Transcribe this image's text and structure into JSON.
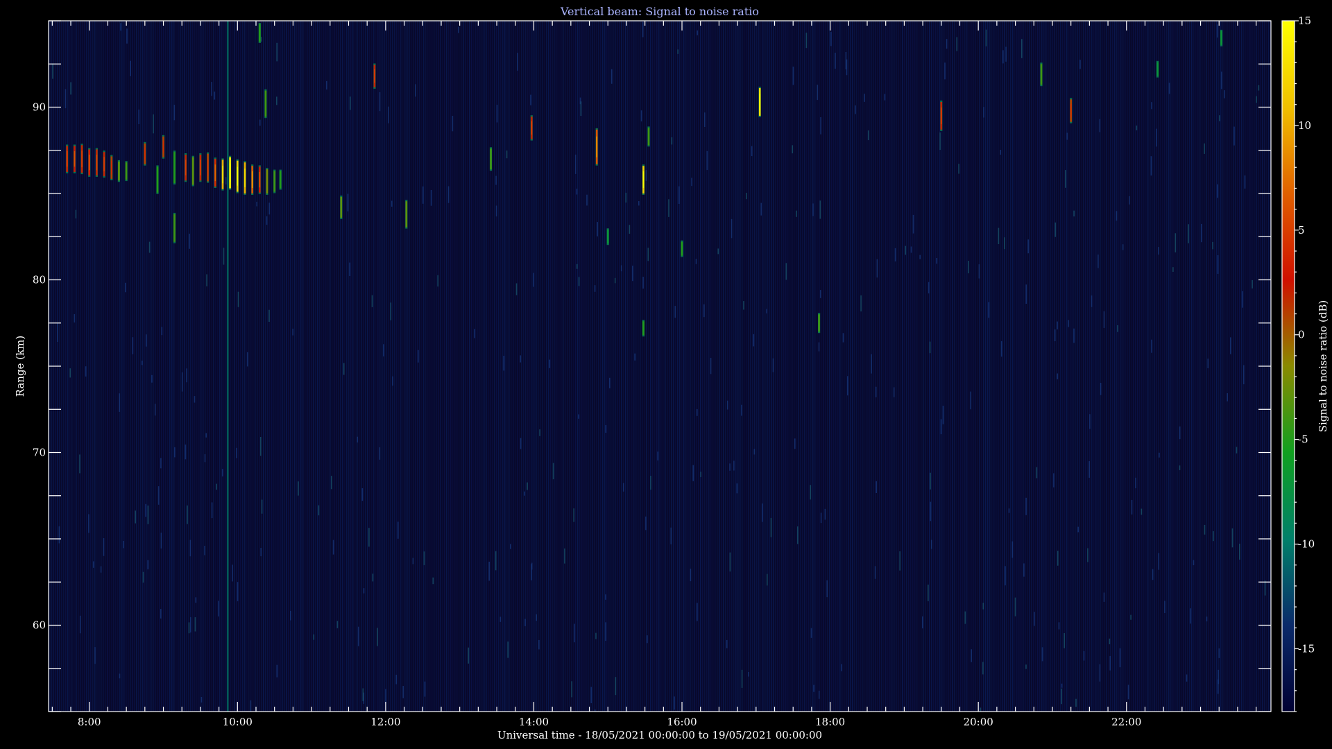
{
  "chart_data": {
    "type": "heatmap",
    "title": "Vertical beam: Signal to noise ratio",
    "xlabel": "Universal time - 18/05/2021 00:00:00 to 19/05/2021 00:00:00",
    "ylabel": "Range (km)",
    "colorbar_label": "Signal to noise ratio (dB)",
    "xlim": [
      7.45,
      23.95
    ],
    "ylim": [
      55,
      95
    ],
    "x_ticks": [
      8,
      10,
      12,
      14,
      16,
      18,
      20,
      22
    ],
    "x_tick_labels": [
      "8:00",
      "10:00",
      "12:00",
      "14:00",
      "16:00",
      "18:00",
      "20:00",
      "22:00"
    ],
    "y_ticks": [
      60,
      70,
      80,
      90
    ],
    "y_tick_labels": [
      "60",
      "70",
      "80",
      "90"
    ],
    "clim": [
      -18,
      15
    ],
    "colorbar_ticks": [
      -15,
      -10,
      -5,
      0,
      5,
      10,
      15
    ],
    "colorbar_tick_labels": [
      "-15",
      "-10",
      "-5",
      "0",
      "5",
      "10",
      "15"
    ],
    "colormap": [
      "#000033",
      "#0a2a6a",
      "#00806a",
      "#10a020",
      "#8a8a00",
      "#d01000",
      "#e06000",
      "#f0c000",
      "#ffff00"
    ],
    "background_color": "#08082a",
    "echoes": [
      {
        "t": 7.7,
        "r": 87.0,
        "h": 1.5,
        "snr": 2
      },
      {
        "t": 7.8,
        "r": 87.0,
        "h": 1.5,
        "snr": 3
      },
      {
        "t": 7.9,
        "r": 87.0,
        "h": 1.6,
        "snr": 2
      },
      {
        "t": 8.0,
        "r": 86.8,
        "h": 1.5,
        "snr": 3
      },
      {
        "t": 8.1,
        "r": 86.8,
        "h": 1.5,
        "snr": 2
      },
      {
        "t": 8.2,
        "r": 86.7,
        "h": 1.4,
        "snr": 2
      },
      {
        "t": 8.3,
        "r": 86.5,
        "h": 1.3,
        "snr": 1
      },
      {
        "t": 8.4,
        "r": 86.3,
        "h": 1.1,
        "snr": -3
      },
      {
        "t": 8.5,
        "r": 86.3,
        "h": 1.0,
        "snr": -4
      },
      {
        "t": 8.75,
        "r": 87.3,
        "h": 1.2,
        "snr": 1
      },
      {
        "t": 8.92,
        "r": 85.8,
        "h": 1.5,
        "snr": -5
      },
      {
        "t": 9.0,
        "r": 87.7,
        "h": 1.2,
        "snr": 1
      },
      {
        "t": 9.15,
        "r": 83.0,
        "h": 1.6,
        "snr": -4
      },
      {
        "t": 9.15,
        "r": 86.5,
        "h": 1.8,
        "snr": -5
      },
      {
        "t": 9.3,
        "r": 86.5,
        "h": 1.5,
        "snr": 2
      },
      {
        "t": 9.4,
        "r": 86.3,
        "h": 1.6,
        "snr": -3
      },
      {
        "t": 9.5,
        "r": 86.5,
        "h": 1.5,
        "snr": 2
      },
      {
        "t": 9.6,
        "r": 86.5,
        "h": 1.6,
        "snr": 1
      },
      {
        "t": 9.7,
        "r": 86.2,
        "h": 1.6,
        "snr": 4
      },
      {
        "t": 9.8,
        "r": 86.1,
        "h": 1.7,
        "snr": 10
      },
      {
        "t": 9.9,
        "r": 86.2,
        "h": 1.8,
        "snr": 14
      },
      {
        "t": 10.0,
        "r": 86.0,
        "h": 1.8,
        "snr": 12
      },
      {
        "t": 10.1,
        "r": 85.9,
        "h": 1.8,
        "snr": 10
      },
      {
        "t": 10.2,
        "r": 85.8,
        "h": 1.6,
        "snr": 6
      },
      {
        "t": 10.3,
        "r": 85.8,
        "h": 1.5,
        "snr": 3
      },
      {
        "t": 10.4,
        "r": 85.7,
        "h": 1.4,
        "snr": -2
      },
      {
        "t": 10.5,
        "r": 85.7,
        "h": 1.2,
        "snr": -4
      },
      {
        "t": 10.58,
        "r": 85.8,
        "h": 1.0,
        "snr": -5
      },
      {
        "t": 10.38,
        "r": 90.2,
        "h": 1.5,
        "snr": -4
      },
      {
        "t": 10.3,
        "r": 94.3,
        "h": 1.0,
        "snr": -5
      },
      {
        "t": 11.4,
        "r": 84.2,
        "h": 1.2,
        "snr": -3
      },
      {
        "t": 11.85,
        "r": 91.8,
        "h": 1.3,
        "snr": 2
      },
      {
        "t": 12.28,
        "r": 83.8,
        "h": 1.5,
        "snr": -3
      },
      {
        "t": 13.42,
        "r": 87.0,
        "h": 1.2,
        "snr": -4
      },
      {
        "t": 13.97,
        "r": 88.8,
        "h": 1.3,
        "snr": 2
      },
      {
        "t": 14.85,
        "r": 87.7,
        "h": 2.0,
        "snr": 6
      },
      {
        "t": 15.48,
        "r": 85.8,
        "h": 1.6,
        "snr": 12
      },
      {
        "t": 15.55,
        "r": 88.3,
        "h": 1.0,
        "snr": -4
      },
      {
        "t": 15.0,
        "r": 82.5,
        "h": 0.8,
        "snr": -7
      },
      {
        "t": 16.0,
        "r": 81.8,
        "h": 0.8,
        "snr": -5
      },
      {
        "t": 15.48,
        "r": 77.2,
        "h": 0.8,
        "snr": -5
      },
      {
        "t": 17.05,
        "r": 90.3,
        "h": 1.6,
        "snr": 13
      },
      {
        "t": 17.85,
        "r": 77.5,
        "h": 1.0,
        "snr": -4
      },
      {
        "t": 19.5,
        "r": 89.5,
        "h": 1.6,
        "snr": 2
      },
      {
        "t": 20.85,
        "r": 91.9,
        "h": 1.2,
        "snr": -4
      },
      {
        "t": 21.25,
        "r": 89.8,
        "h": 1.3,
        "snr": 1
      },
      {
        "t": 22.42,
        "r": 92.2,
        "h": 0.8,
        "snr": -7
      },
      {
        "t": 23.28,
        "r": 94.0,
        "h": 0.8,
        "snr": -7
      },
      {
        "t": 9.87,
        "r": 75.0,
        "h": 40.0,
        "snr": -10
      }
    ]
  }
}
